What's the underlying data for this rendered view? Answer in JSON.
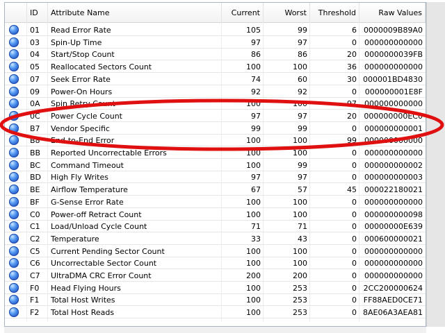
{
  "columns": {
    "id": "ID",
    "name": "Attribute Name",
    "current": "Current",
    "worst": "Worst",
    "threshold": "Threshold",
    "raw": "Raw Values"
  },
  "rows": [
    {
      "id": "01",
      "name": "Read Error Rate",
      "current": "105",
      "worst": "99",
      "threshold": "6",
      "raw": "0000009B89A0"
    },
    {
      "id": "03",
      "name": "Spin-Up Time",
      "current": "97",
      "worst": "97",
      "threshold": "0",
      "raw": "000000000000"
    },
    {
      "id": "04",
      "name": "Start/Stop Count",
      "current": "86",
      "worst": "86",
      "threshold": "20",
      "raw": "0000000039FB"
    },
    {
      "id": "05",
      "name": "Reallocated Sectors Count",
      "current": "100",
      "worst": "100",
      "threshold": "36",
      "raw": "000000000000"
    },
    {
      "id": "07",
      "name": "Seek Error Rate",
      "current": "74",
      "worst": "60",
      "threshold": "30",
      "raw": "000001BD4830"
    },
    {
      "id": "09",
      "name": "Power-On Hours",
      "current": "92",
      "worst": "92",
      "threshold": "0",
      "raw": "000000001E8F"
    },
    {
      "id": "0A",
      "name": "Spin Retry Count",
      "current": "100",
      "worst": "100",
      "threshold": "97",
      "raw": "000000000000"
    },
    {
      "id": "0C",
      "name": "Power Cycle Count",
      "current": "97",
      "worst": "97",
      "threshold": "20",
      "raw": "000000000EC0"
    },
    {
      "id": "B7",
      "name": "Vendor Specific",
      "current": "99",
      "worst": "99",
      "threshold": "0",
      "raw": "000000000001"
    },
    {
      "id": "B8",
      "name": "End-to-End Error",
      "current": "100",
      "worst": "100",
      "threshold": "99",
      "raw": "000000000000"
    },
    {
      "id": "BB",
      "name": "Reported Uncorrectable Errors",
      "current": "100",
      "worst": "100",
      "threshold": "0",
      "raw": "000000000000"
    },
    {
      "id": "BC",
      "name": "Command Timeout",
      "current": "100",
      "worst": "99",
      "threshold": "0",
      "raw": "000000000002"
    },
    {
      "id": "BD",
      "name": "High Fly Writes",
      "current": "97",
      "worst": "97",
      "threshold": "0",
      "raw": "000000000003"
    },
    {
      "id": "BE",
      "name": "Airflow Temperature",
      "current": "67",
      "worst": "57",
      "threshold": "45",
      "raw": "000022180021"
    },
    {
      "id": "BF",
      "name": "G-Sense Error Rate",
      "current": "100",
      "worst": "100",
      "threshold": "0",
      "raw": "000000000000"
    },
    {
      "id": "C0",
      "name": "Power-off Retract Count",
      "current": "100",
      "worst": "100",
      "threshold": "0",
      "raw": "000000000098"
    },
    {
      "id": "C1",
      "name": "Load/Unload Cycle Count",
      "current": "71",
      "worst": "71",
      "threshold": "0",
      "raw": "00000000E639"
    },
    {
      "id": "C2",
      "name": "Temperature",
      "current": "33",
      "worst": "43",
      "threshold": "0",
      "raw": "000600000021"
    },
    {
      "id": "C5",
      "name": "Current Pending Sector Count",
      "current": "100",
      "worst": "100",
      "threshold": "0",
      "raw": "000000000000"
    },
    {
      "id": "C6",
      "name": "Uncorrectable Sector Count",
      "current": "100",
      "worst": "100",
      "threshold": "0",
      "raw": "000000000000"
    },
    {
      "id": "C7",
      "name": "UltraDMA CRC Error Count",
      "current": "200",
      "worst": "200",
      "threshold": "0",
      "raw": "000000000000"
    },
    {
      "id": "F0",
      "name": "Head Flying Hours",
      "current": "100",
      "worst": "253",
      "threshold": "0",
      "raw": "2CC200000624"
    },
    {
      "id": "F1",
      "name": "Total Host Writes",
      "current": "100",
      "worst": "253",
      "threshold": "0",
      "raw": "FF88AED0CE71"
    },
    {
      "id": "F2",
      "name": "Total Host Reads",
      "current": "100",
      "worst": "253",
      "threshold": "0",
      "raw": "8AE06A3AEA81"
    }
  ],
  "status_icon": "blue-orb-icon",
  "colors": {
    "status_icon": "#2f6fe0",
    "annotation": "#e01010",
    "header_bg": "#f4f4f4",
    "grid": "#e6e6e6"
  }
}
